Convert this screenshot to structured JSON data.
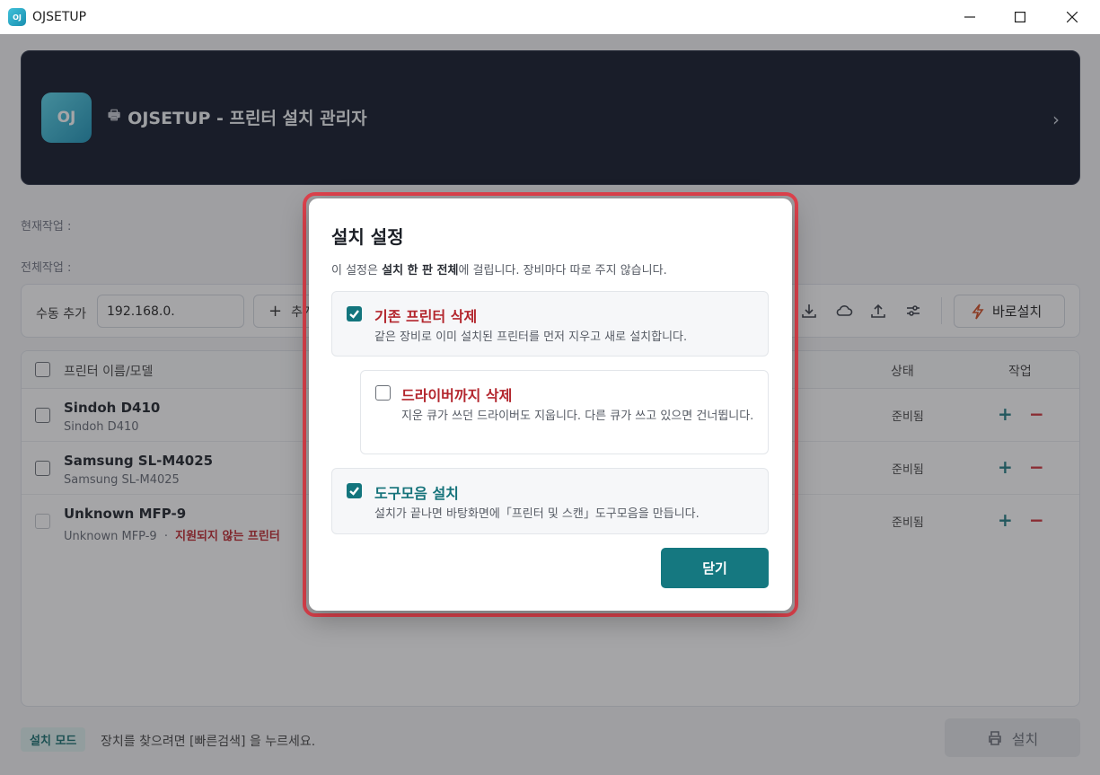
{
  "window": {
    "title": "OJSETUP",
    "app_icon_text": "OJ"
  },
  "header": {
    "logo_text": "OJ",
    "title": "OJSETUP - 프린터 설치 관리자"
  },
  "status": {
    "current_label": "현재작업 :",
    "total_label": "전체작업 :"
  },
  "toolbar": {
    "manual_add_label": "수동 추가",
    "ip_value": "192.168.0.",
    "add_button_label": "추가",
    "quick_install_label": "바로설치"
  },
  "table": {
    "columns": {
      "name": "프린터 이름/모델",
      "status": "상태",
      "actions": "작업"
    },
    "rows": [
      {
        "name": "Sindoh D410",
        "model": "Sindoh D410",
        "warning": "",
        "status": "준비됨"
      },
      {
        "name": "Samsung SL-M4025",
        "model": "Samsung SL-M4025",
        "warning": "",
        "status": "준비됨"
      },
      {
        "name": "Unknown MFP-9",
        "model": "Unknown MFP-9",
        "separator": "·",
        "warning": "지원되지 않는 프린터",
        "status": "준비됨"
      }
    ],
    "plus_symbol": "+",
    "minus_symbol": "−"
  },
  "footer": {
    "mode_badge": "설치 모드",
    "hint": "장치를 찾으려면 [빠른검색] 을 누르세요.",
    "install_label": "설치"
  },
  "modal": {
    "title": "설치 설정",
    "desc_prefix": "이 설정은 ",
    "desc_bold": "설치 한 판 전체",
    "desc_suffix": "에 걸립니다. 장비마다 따로 주지 않습니다.",
    "options": [
      {
        "title": "기존 프린터 삭제",
        "desc": "같은 장비로 이미 설치된 프린터를 먼저 지우고 새로 설치합니다.",
        "checked": true
      },
      {
        "title": "드라이버까지 삭제",
        "desc": "지운 큐가 쓰던 드라이버도 지웁니다. 다른 큐가 쓰고 있으면 건너뜁니다.",
        "checked": false
      },
      {
        "title": "도구모음 설치",
        "desc": "설치가 끝나면 바탕화면에「프린터 및 스캔」도구모음을 만듭니다.",
        "checked": true
      }
    ],
    "close_label": "닫기"
  },
  "colors": {
    "accent": "#157880",
    "danger": "#b3262d",
    "highlight_outline": "#e0424d",
    "header_bg": "#0f1626"
  }
}
